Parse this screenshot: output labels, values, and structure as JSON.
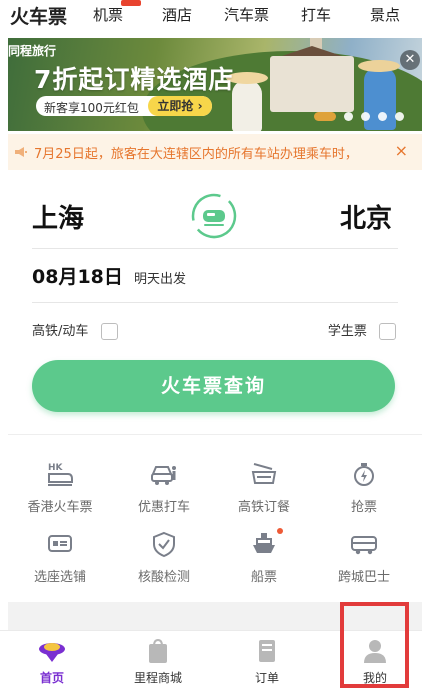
{
  "top_tabs": [
    {
      "label": "火车票",
      "active": true
    },
    {
      "label": "机票",
      "active": false
    },
    {
      "label": "酒店",
      "active": false
    },
    {
      "label": "汽车票",
      "active": false
    },
    {
      "label": "打车",
      "active": false
    },
    {
      "label": "景点",
      "active": false
    }
  ],
  "banner": {
    "brand": "同程旅行",
    "headline": "7折起订精选酒店",
    "pill_text": "新客享100元红包",
    "pill_button": "立即抢",
    "close_icon": "close-icon"
  },
  "notice": {
    "text": "7月25日起，旅客在大连辖区内的所有车站办理乘车时，",
    "close": "×"
  },
  "search": {
    "from_city": "上海",
    "to_city": "北京",
    "date": "08月18日",
    "date_hint": "明天出发",
    "option_high_speed": "高铁/动车",
    "option_student": "学生票",
    "search_button": "火车票查询"
  },
  "services": [
    {
      "label": "香港火车票",
      "icon": "hk-train-icon"
    },
    {
      "label": "优惠打车",
      "icon": "taxi-icon"
    },
    {
      "label": "高铁订餐",
      "icon": "meal-icon"
    },
    {
      "label": "抢票",
      "icon": "stopwatch-icon"
    },
    {
      "label": "选座选铺",
      "icon": "seat-icon"
    },
    {
      "label": "核酸检测",
      "icon": "shield-check-icon"
    },
    {
      "label": "船票",
      "icon": "ship-icon"
    },
    {
      "label": "跨城巴士",
      "icon": "bus-icon"
    }
  ],
  "bottom_nav": [
    {
      "label": "首页",
      "active": true,
      "icon": "home-icon"
    },
    {
      "label": "里程商城",
      "active": false,
      "icon": "shopping-bag-icon"
    },
    {
      "label": "订单",
      "active": false,
      "icon": "order-icon"
    },
    {
      "label": "我的",
      "active": false,
      "icon": "profile-icon"
    }
  ],
  "colors": {
    "primary_green": "#5cc98c",
    "notice_orange": "#e6762e",
    "nav_active_purple": "#7a2fd1",
    "highlight_red": "#e23b3b",
    "tab_underline_yellow": "#f6d44a"
  }
}
